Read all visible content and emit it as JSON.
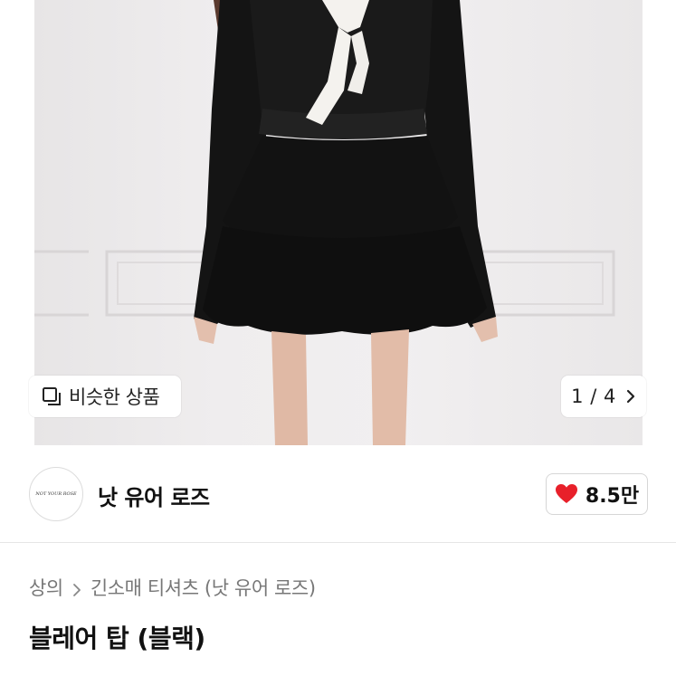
{
  "gallery": {
    "similar_label": "비슷한 상품",
    "similar_icon": "similar-products-icon",
    "pager": "1 / 4",
    "pager_icon": "chevron-right-icon"
  },
  "shop": {
    "name": "낫 유어 로즈",
    "avatar_text": "NOT YOUR ROSE",
    "likes": "8.5만",
    "like_icon": "heart-icon",
    "like_color": "#e8202a"
  },
  "breadcrumb": {
    "category": "상의",
    "subcategory": "긴소매 티셔츠 (낫 유어 로즈)"
  },
  "product": {
    "title": "블레어 탑 (블랙)"
  }
}
